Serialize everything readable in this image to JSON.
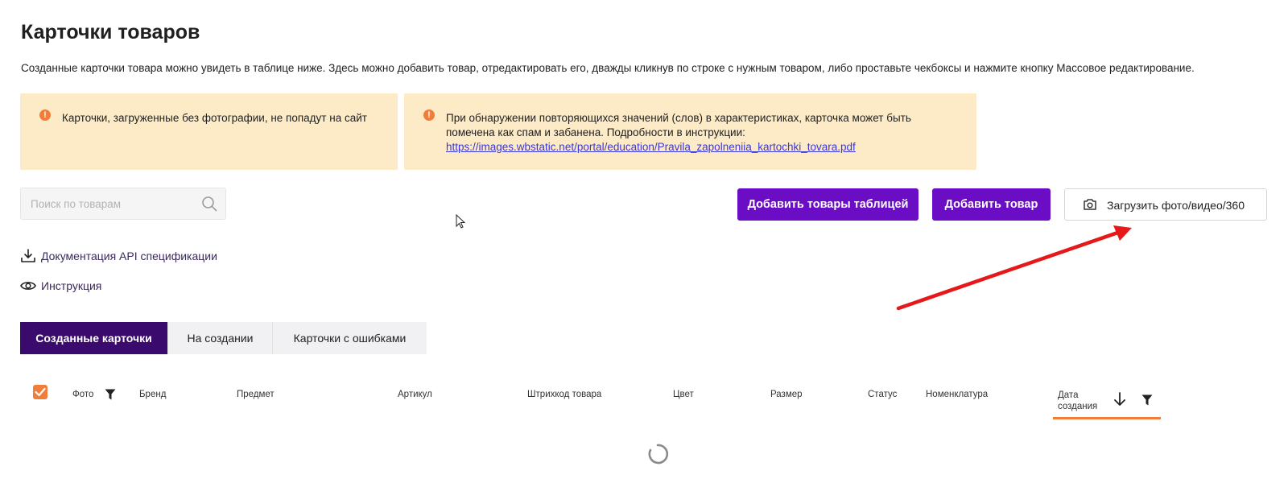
{
  "page": {
    "title": "Карточки товаров",
    "description": "Созданные карточки товара можно увидеть в таблице ниже. Здесь можно добавить товар, отредактировать его, дважды кликнув по строке с нужным товаром, либо проставьте чекбоксы и нажмите кнопку Массовое редактирование."
  },
  "alerts": [
    {
      "icon": "exclamation-icon",
      "text": "Карточки, загруженные без фотографии, не попадут на сайт"
    },
    {
      "icon": "exclamation-icon",
      "text_line1": "При обнаружении повторяющихся значений (слов) в характеристиках, карточка может быть",
      "text_line2": "помечена как спам и забанена. Подробности в инструкции:",
      "link": "https://images.wbstatic.net/portal/education/Pravila_zapolneniia_kartochki_tovara.pdf"
    }
  ],
  "search": {
    "placeholder": "Поиск по товарам",
    "value": ""
  },
  "buttons": {
    "add_table": "Добавить товары таблицей",
    "add_product": "Добавить товар",
    "upload_media": "Загрузить фото/видео/360"
  },
  "links": {
    "api_docs": "Документация API спецификации",
    "instruction": "Инструкция"
  },
  "tabs": [
    {
      "label": "Созданные карточки",
      "active": true
    },
    {
      "label": "На создании",
      "active": false
    },
    {
      "label": "Карточки с ошибками",
      "active": false
    }
  ],
  "table": {
    "select_all_checked": true,
    "columns": {
      "photo": "Фото",
      "brand": "Бренд",
      "subject": "Предмет",
      "article": "Артикул",
      "barcode": "Штрихкод товара",
      "color": "Цвет",
      "size": "Размер",
      "status": "Статус",
      "nomenclature": "Номенклатура",
      "created_line1": "Дата",
      "created_line2": "создания"
    },
    "loading": true
  },
  "colors": {
    "primary": "#6a0dc4",
    "tab_active": "#3a0a6c",
    "alert_bg": "#fdebc8",
    "accent_orange": "#f07e3a",
    "annotation_arrow": "#e51919"
  }
}
